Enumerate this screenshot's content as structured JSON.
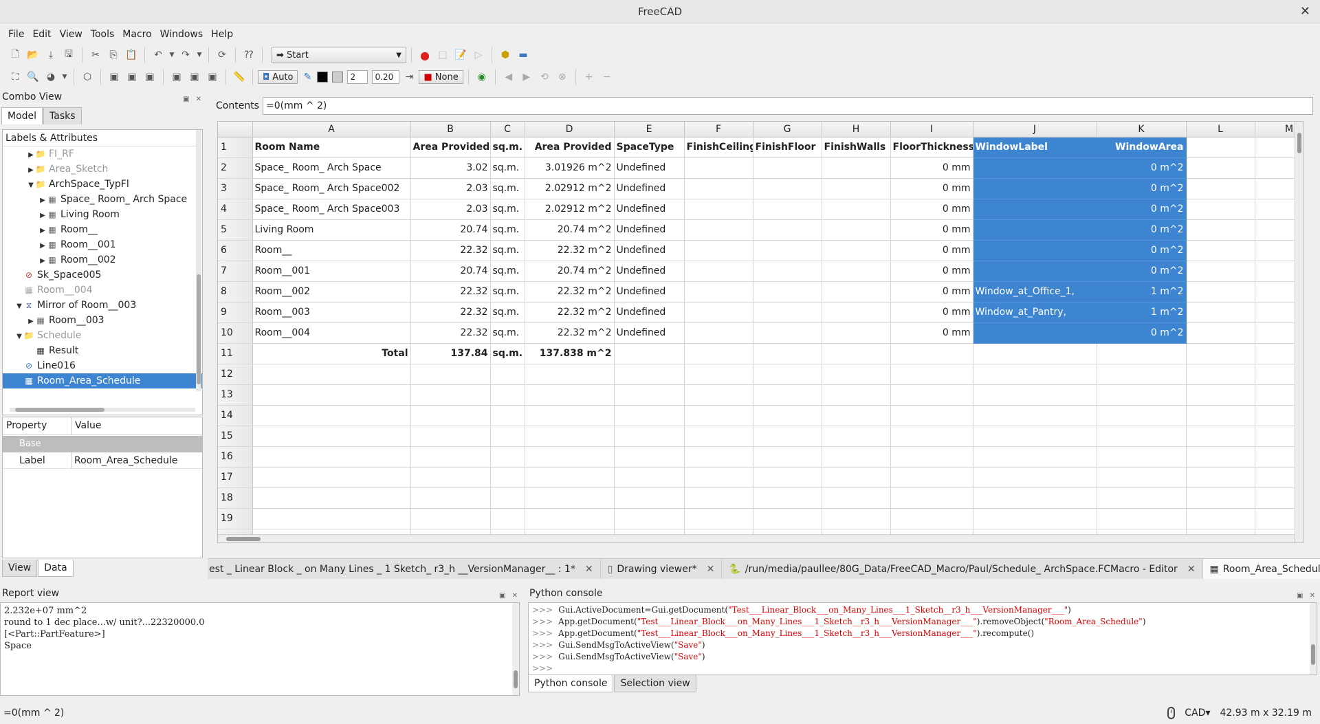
{
  "window": {
    "title": "FreeCAD"
  },
  "menu": [
    "File",
    "Edit",
    "View",
    "Tools",
    "Macro",
    "Windows",
    "Help"
  ],
  "toolbar": {
    "workbench": "Start",
    "draw_style": "Auto",
    "line_width": "2",
    "point_size": "0.20",
    "construction_mode": "None"
  },
  "combo": {
    "title": "Combo View",
    "tabs": [
      "Model",
      "Tasks"
    ],
    "tree_header": "Labels & Attributes",
    "tree": [
      {
        "label": "FI_RF",
        "indent": 1,
        "exp": "▶",
        "icon": "folder",
        "grey": true
      },
      {
        "label": "Area_Sketch",
        "indent": 1,
        "exp": "▶",
        "icon": "folder",
        "grey": true
      },
      {
        "label": "ArchSpace_TypFl",
        "indent": 1,
        "exp": "▼",
        "icon": "folder",
        "grey": false
      },
      {
        "label": "Space_ Room_ Arch Space",
        "indent": 2,
        "exp": "▶",
        "icon": "space",
        "grey": false
      },
      {
        "label": "Living Room",
        "indent": 2,
        "exp": "▶",
        "icon": "space",
        "grey": false
      },
      {
        "label": "Room__",
        "indent": 2,
        "exp": "▶",
        "icon": "space",
        "grey": false
      },
      {
        "label": "Room__001",
        "indent": 2,
        "exp": "▶",
        "icon": "space",
        "grey": false
      },
      {
        "label": "Room__002",
        "indent": 2,
        "exp": "▶",
        "icon": "space",
        "grey": false
      },
      {
        "label": "Sk_Space005",
        "indent": 0,
        "exp": "",
        "icon": "sketch",
        "grey": false
      },
      {
        "label": "Room__004",
        "indent": 0,
        "exp": "",
        "icon": "space",
        "grey": true
      },
      {
        "label": "Mirror of Room__003",
        "indent": 0,
        "exp": "▼",
        "icon": "mirror",
        "grey": false
      },
      {
        "label": "Room__003",
        "indent": 1,
        "exp": "▶",
        "icon": "space",
        "grey": false
      },
      {
        "label": "Schedule",
        "indent": 0,
        "exp": "▼",
        "icon": "folder",
        "grey": true
      },
      {
        "label": "Result",
        "indent": 1,
        "exp": "",
        "icon": "table",
        "grey": false
      },
      {
        "label": "Line016",
        "indent": 0,
        "exp": "",
        "icon": "line",
        "grey": false
      },
      {
        "label": "Room_Area_Schedule",
        "indent": 0,
        "exp": "",
        "icon": "table",
        "grey": false,
        "selected": true
      }
    ],
    "props_header": [
      "Property",
      "Value"
    ],
    "prop_group": "Base",
    "props": [
      {
        "name": "Label",
        "value": "Room_Area_Schedule"
      }
    ],
    "bottom_tabs": [
      "View",
      "Data"
    ]
  },
  "contents": {
    "label": "Contents",
    "value": "=0(mm ^ 2)"
  },
  "sheet": {
    "columns": [
      "A",
      "B",
      "C",
      "D",
      "E",
      "F",
      "G",
      "H",
      "I",
      "J",
      "K",
      "L",
      "M"
    ],
    "rows": [
      [
        "Room Name",
        "Area Provided",
        "sq.m.",
        "Area Provided",
        "SpaceType",
        "FinishCeiling",
        "FinishFloor",
        "FinishWalls",
        "FloorThickness",
        "WindowLabel",
        "WindowArea",
        "",
        ""
      ],
      [
        "Space_ Room_ Arch Space",
        "3.02",
        "sq.m.",
        "3.01926 m^2",
        "Undefined",
        "",
        "",
        "",
        "0 mm",
        "",
        "0 m^2",
        "",
        ""
      ],
      [
        "Space_ Room_ Arch Space002",
        "2.03",
        "sq.m.",
        "2.02912 m^2",
        "Undefined",
        "",
        "",
        "",
        "0 mm",
        "",
        "0 m^2",
        "",
        ""
      ],
      [
        "Space_ Room_ Arch Space003",
        "2.03",
        "sq.m.",
        "2.02912 m^2",
        "Undefined",
        "",
        "",
        "",
        "0 mm",
        "",
        "0 m^2",
        "",
        ""
      ],
      [
        "Living Room",
        "20.74",
        "sq.m.",
        "20.74 m^2",
        "Undefined",
        "",
        "",
        "",
        "0 mm",
        "",
        "0 m^2",
        "",
        ""
      ],
      [
        "Room__",
        "22.32",
        "sq.m.",
        "22.32 m^2",
        "Undefined",
        "",
        "",
        "",
        "0 mm",
        "",
        "0 m^2",
        "",
        ""
      ],
      [
        "Room__001",
        "20.74",
        "sq.m.",
        "20.74 m^2",
        "Undefined",
        "",
        "",
        "",
        "0 mm",
        "",
        "0 m^2",
        "",
        ""
      ],
      [
        "Room__002",
        "22.32",
        "sq.m.",
        "22.32 m^2",
        "Undefined",
        "",
        "",
        "",
        "0 mm",
        "Window_at_Office_1,",
        "1 m^2",
        "",
        ""
      ],
      [
        "Room__003",
        "22.32",
        "sq.m.",
        "22.32 m^2",
        "Undefined",
        "",
        "",
        "",
        "0 mm",
        "Window_at_Pantry,",
        "1 m^2",
        "",
        ""
      ],
      [
        "Room__004",
        "22.32",
        "sq.m.",
        "22.32 m^2",
        "Undefined",
        "",
        "",
        "",
        "0 mm",
        "",
        "0 m^2",
        "",
        ""
      ],
      [
        "Total",
        "137.84",
        "sq.m.",
        "137.838 m^2",
        "",
        "",
        "",
        "",
        "",
        "",
        "",
        "",
        ""
      ]
    ],
    "total_rows": 20
  },
  "doc_tabs": [
    {
      "label": "est _ Linear Block _ on Many Lines _ 1 Sketch_ r3_h __VersionManager__ : 1*",
      "icon": "",
      "active": false
    },
    {
      "label": "Drawing viewer*",
      "icon": "page",
      "active": false
    },
    {
      "label": "/run/media/paullee/80G_Data/FreeCAD_Macro/Paul/Schedule_ ArchSpace.FCMacro - Editor",
      "icon": "python",
      "active": false
    },
    {
      "label": "Room_Area_Schedule",
      "icon": "table",
      "active": true
    }
  ],
  "report": {
    "title": "Report view",
    "lines": [
      "2.232e+07 mm^2",
      "round to 1 dec place...w/ unit?...22320000.0",
      "[<Part::PartFeature>]",
      "Space"
    ]
  },
  "python": {
    "title": "Python console",
    "lines": [
      [
        {
          "t": "Gui.ActiveDocument=Gui.getDocument("
        },
        {
          "s": "\"Test___Linear_Block___on_Many_Lines___1_Sketch__r3_h___VersionManager___\""
        },
        {
          "t": ")"
        }
      ],
      [
        {
          "t": "App.getDocument("
        },
        {
          "s": "\"Test___Linear_Block___on_Many_Lines___1_Sketch__r3_h___VersionManager___\""
        },
        {
          "t": ").removeObject("
        },
        {
          "s": "\"Room_Area_Schedule\""
        },
        {
          "t": ")"
        }
      ],
      [
        {
          "t": "App.getDocument("
        },
        {
          "s": "\"Test___Linear_Block___on_Many_Lines___1_Sketch__r3_h___VersionManager___\""
        },
        {
          "t": ").recompute()"
        }
      ],
      [
        {
          "t": "Gui.SendMsgToActiveView("
        },
        {
          "s": "\"Save\""
        },
        {
          "t": ")"
        }
      ],
      [
        {
          "t": "Gui.SendMsgToActiveView("
        },
        {
          "s": "\"Save\""
        },
        {
          "t": ")"
        }
      ],
      []
    ],
    "prompt": ">>>",
    "tabs": [
      "Python console",
      "Selection view"
    ]
  },
  "status": {
    "left": "=0(mm ^ 2)",
    "nav": "CAD",
    "dimensions": "42.93 m x 32.19 m"
  }
}
